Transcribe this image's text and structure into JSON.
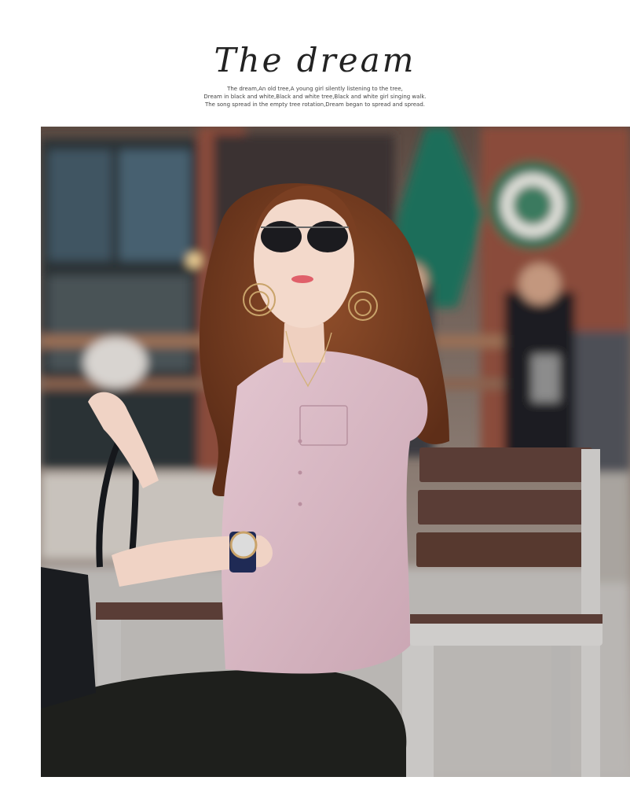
{
  "header": {
    "title": "The dream",
    "lines": [
      "The dream,An old tree,A young girl silently listening to the tree,",
      "Dream in black and white,Black and white tree,Black and white girl singing walk.",
      "The song spread in the empty tree rotation,Dream began to spread and spread."
    ]
  },
  "photo": {
    "description_icon": "photo-icon",
    "colors": {
      "shirt": "#d9b9c4",
      "pants": "#1e1f1c",
      "hair": "#7a3f22",
      "bench_wood": "#5a3d36",
      "bench_metal": "#c9c7c5",
      "umbrella": "#1f6e5a",
      "brick": "#8a4b3a",
      "pavement": "#b9b6b3"
    }
  }
}
